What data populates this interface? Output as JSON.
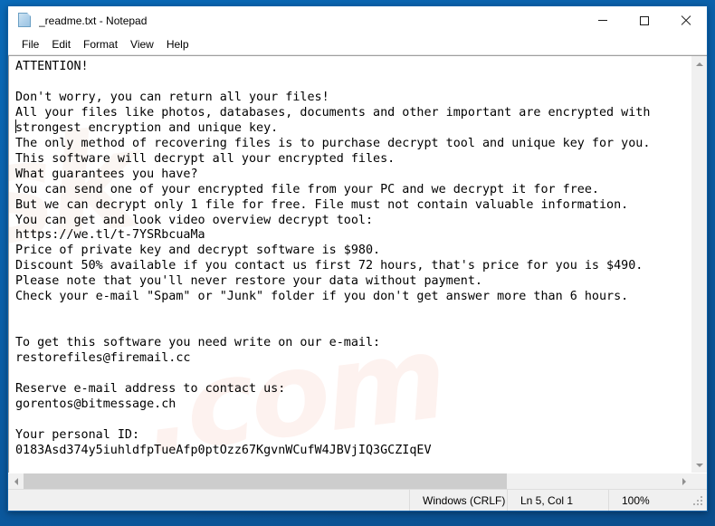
{
  "window": {
    "title": "_readme.txt - Notepad",
    "icon": "text-document-icon",
    "controls": {
      "minimize": "Minimize",
      "maximize": "Maximize",
      "close": "Close"
    }
  },
  "menu": {
    "items": [
      {
        "label": "File"
      },
      {
        "label": "Edit"
      },
      {
        "label": "Format"
      },
      {
        "label": "View"
      },
      {
        "label": "Help"
      }
    ]
  },
  "editor": {
    "watermark": ".com",
    "watermark2": "sk",
    "content": "ATTENTION!\n\nDon't worry, you can return all your files!\nAll your files like photos, databases, documents and other important are encrypted with\nstrongest encryption and unique key.\nThe only method of recovering files is to purchase decrypt tool and unique key for you.\nThis software will decrypt all your encrypted files.\nWhat guarantees you have?\nYou can send one of your encrypted file from your PC and we decrypt it for free.\nBut we can decrypt only 1 file for free. File must not contain valuable information.\nYou can get and look video overview decrypt tool:\nhttps://we.tl/t-7YSRbcuaMa\nPrice of private key and decrypt software is $980.\nDiscount 50% available if you contact us first 72 hours, that's price for you is $490.\nPlease note that you'll never restore your data without payment.\nCheck your e-mail \"Spam\" or \"Junk\" folder if you don't get answer more than 6 hours.\n\n\nTo get this software you need write on our e-mail:\nrestorefiles@firemail.cc\n\nReserve e-mail address to contact us:\ngorentos@bitmessage.ch\n\nYour personal ID:\n0183Asd374y5iuhldfpTueAfp0ptOzz67KgvnWCufW4JBVjIQ3GCZIqEV",
    "details": {
      "video_url": "https://we.tl/t-7YSRbcuaMa",
      "price": "$980",
      "discount_price": "$490",
      "discount_percent": "50%",
      "discount_window": "72 hours",
      "response_time": "6 hours",
      "free_files": "1 file",
      "primary_email": "restorefiles@firemail.cc",
      "reserve_email": "gorentos@bitmessage.ch",
      "personal_id": "0183Asd374y5iuhldfpTueAfp0ptOzz67KgvnWCufW4JBVjIQ3GCZIqEV"
    }
  },
  "scrollbars": {
    "vertical": {
      "up": "Scroll up",
      "down": "Scroll down"
    },
    "horizontal": {
      "left": "Scroll left",
      "right": "Scroll right"
    }
  },
  "statusbar": {
    "encoding": "Windows (CRLF)",
    "position": "Ln 5, Col 1",
    "zoom": "100%"
  },
  "colors": {
    "desktop": "#0b5ea6",
    "window_bg": "#ffffff",
    "statusbar_bg": "#f0f0f0",
    "text": "#000000",
    "scroll_thumb": "#cdcdcd"
  }
}
